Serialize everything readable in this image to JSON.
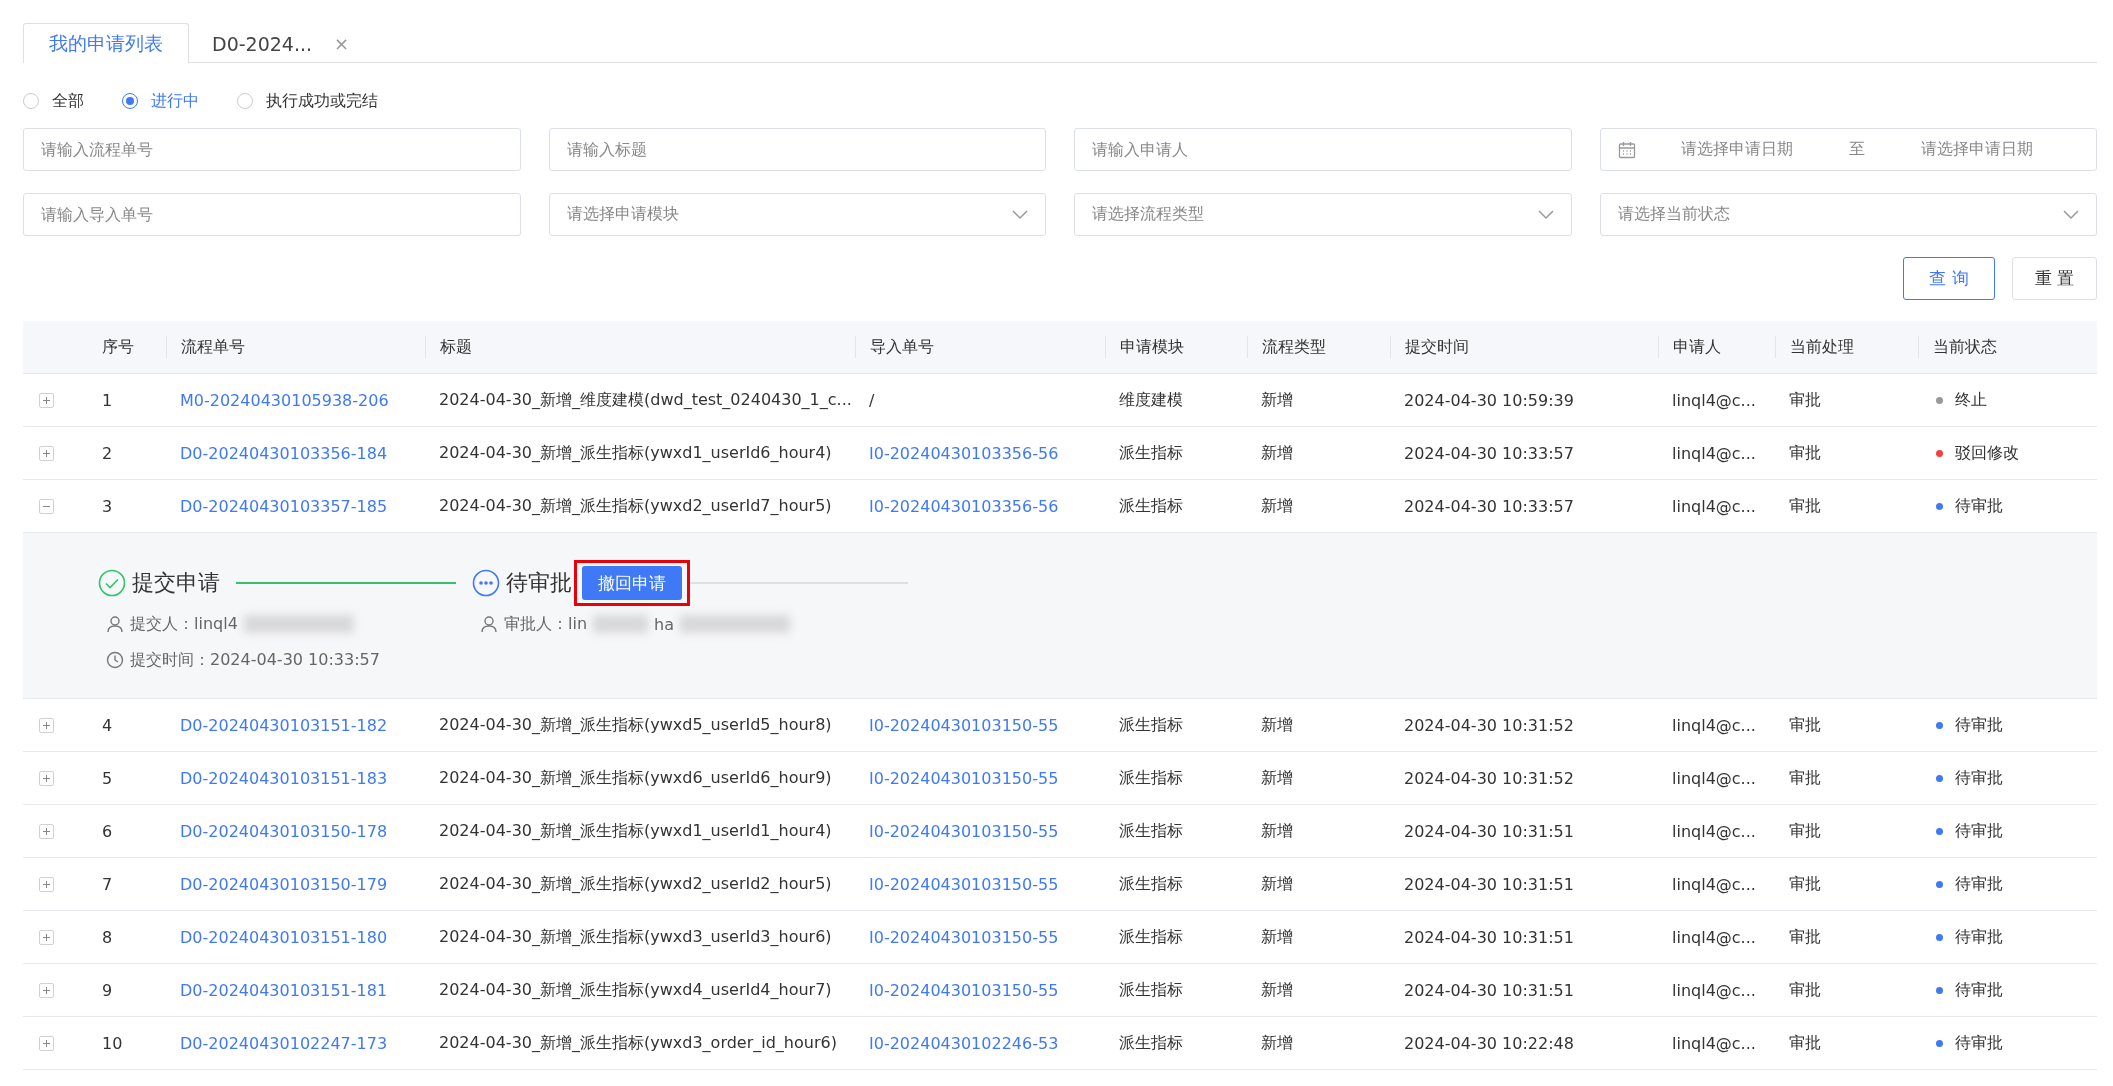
{
  "tabs": [
    {
      "label": "我的申请列表",
      "selected": true,
      "closable": false
    },
    {
      "label": "D0-2024...",
      "selected": false,
      "closable": true,
      "close_glyph": "×"
    }
  ],
  "status_filter": [
    {
      "label": "全部",
      "selected": false
    },
    {
      "label": "进行中",
      "selected": true
    },
    {
      "label": "执行成功或完结",
      "selected": false
    }
  ],
  "filters": [
    {
      "kind": "input",
      "placeholder": "请输入流程单号"
    },
    {
      "kind": "input",
      "placeholder": "请输入标题"
    },
    {
      "kind": "input",
      "placeholder": "请输入申请人"
    },
    {
      "kind": "daterange",
      "start_placeholder": "请选择申请日期",
      "separator": "至",
      "end_placeholder": "请选择申请日期"
    },
    {
      "kind": "input",
      "placeholder": "请输入导入单号"
    },
    {
      "kind": "select",
      "placeholder": "请选择申请模块"
    },
    {
      "kind": "select",
      "placeholder": "请选择流程类型"
    },
    {
      "kind": "select",
      "placeholder": "请选择当前状态"
    }
  ],
  "buttons": [
    {
      "label": "查 询",
      "kind": "primary"
    },
    {
      "label": "重 置",
      "kind": "default"
    }
  ],
  "table": {
    "columns": [
      "序号",
      "流程单号",
      "标题",
      "导入单号",
      "申请模块",
      "流程类型",
      "提交时间",
      "申请人",
      "当前处理",
      "当前状态"
    ],
    "rows": [
      {
        "expanded": false,
        "index": "1",
        "flow_no": "M0-20240430105938-206",
        "title": "2024-04-30_新增_维度建模(dwd_test_0240430_1_c...",
        "import_no": {
          "text": "/",
          "link": false
        },
        "module": "维度建模",
        "type": "新增",
        "time": "2024-04-30 10:59:39",
        "applicant": "linql4@c...",
        "handler": "审批",
        "status": {
          "label": "终止",
          "color": "#999999"
        }
      },
      {
        "expanded": false,
        "index": "2",
        "flow_no": "D0-20240430103356-184",
        "title": "2024-04-30_新增_派生指标(ywxd1_userId6_hour4)",
        "import_no": {
          "text": "I0-20240430103356-56",
          "link": true
        },
        "module": "派生指标",
        "type": "新增",
        "time": "2024-04-30 10:33:57",
        "applicant": "linql4@c...",
        "handler": "审批",
        "status": {
          "label": "驳回修改",
          "color": "#f5403d"
        }
      },
      {
        "expanded": true,
        "index": "3",
        "flow_no": "D0-20240430103357-185",
        "title": "2024-04-30_新增_派生指标(ywxd2_userId7_hour5)",
        "import_no": {
          "text": "I0-20240430103356-56",
          "link": true
        },
        "module": "派生指标",
        "type": "新增",
        "time": "2024-04-30 10:33:57",
        "applicant": "linql4@c...",
        "handler": "审批",
        "status": {
          "label": "待审批",
          "color": "#3f79f5"
        },
        "detail": {
          "steps": [
            {
              "label": "提交申请",
              "kind": "done",
              "lines": [
                {
                  "kind": "person",
                  "text": "提交人：linql4",
                  "redacted": true
                },
                {
                  "kind": "time",
                  "text": "提交时间：2024-04-30 10:33:57",
                  "redacted": false
                }
              ]
            },
            {
              "label": "待审批",
              "kind": "pending",
              "action": {
                "label": "撤回申请",
                "highlighted": true
              },
              "lines": [
                {
                  "kind": "person",
                  "text": "审批人：lin",
                  "redacted": true,
                  "tail": "ha"
                }
              ]
            }
          ]
        }
      },
      {
        "expanded": false,
        "index": "4",
        "flow_no": "D0-20240430103151-182",
        "title": "2024-04-30_新增_派生指标(ywxd5_userId5_hour8)",
        "import_no": {
          "text": "I0-20240430103150-55",
          "link": true
        },
        "module": "派生指标",
        "type": "新增",
        "time": "2024-04-30 10:31:52",
        "applicant": "linql4@c...",
        "handler": "审批",
        "status": {
          "label": "待审批",
          "color": "#3f79f5"
        }
      },
      {
        "expanded": false,
        "index": "5",
        "flow_no": "D0-20240430103151-183",
        "title": "2024-04-30_新增_派生指标(ywxd6_userId6_hour9)",
        "import_no": {
          "text": "I0-20240430103150-55",
          "link": true
        },
        "module": "派生指标",
        "type": "新增",
        "time": "2024-04-30 10:31:52",
        "applicant": "linql4@c...",
        "handler": "审批",
        "status": {
          "label": "待审批",
          "color": "#3f79f5"
        }
      },
      {
        "expanded": false,
        "index": "6",
        "flow_no": "D0-20240430103150-178",
        "title": "2024-04-30_新增_派生指标(ywxd1_userId1_hour4)",
        "import_no": {
          "text": "I0-20240430103150-55",
          "link": true
        },
        "module": "派生指标",
        "type": "新增",
        "time": "2024-04-30 10:31:51",
        "applicant": "linql4@c...",
        "handler": "审批",
        "status": {
          "label": "待审批",
          "color": "#3f79f5"
        }
      },
      {
        "expanded": false,
        "index": "7",
        "flow_no": "D0-20240430103150-179",
        "title": "2024-04-30_新增_派生指标(ywxd2_userId2_hour5)",
        "import_no": {
          "text": "I0-20240430103150-55",
          "link": true
        },
        "module": "派生指标",
        "type": "新增",
        "time": "2024-04-30 10:31:51",
        "applicant": "linql4@c...",
        "handler": "审批",
        "status": {
          "label": "待审批",
          "color": "#3f79f5"
        }
      },
      {
        "expanded": false,
        "index": "8",
        "flow_no": "D0-20240430103151-180",
        "title": "2024-04-30_新增_派生指标(ywxd3_userId3_hour6)",
        "import_no": {
          "text": "I0-20240430103150-55",
          "link": true
        },
        "module": "派生指标",
        "type": "新增",
        "time": "2024-04-30 10:31:51",
        "applicant": "linql4@c...",
        "handler": "审批",
        "status": {
          "label": "待审批",
          "color": "#3f79f5"
        }
      },
      {
        "expanded": false,
        "index": "9",
        "flow_no": "D0-20240430103151-181",
        "title": "2024-04-30_新增_派生指标(ywxd4_userId4_hour7)",
        "import_no": {
          "text": "I0-20240430103150-55",
          "link": true
        },
        "module": "派生指标",
        "type": "新增",
        "time": "2024-04-30 10:31:51",
        "applicant": "linql4@c...",
        "handler": "审批",
        "status": {
          "label": "待审批",
          "color": "#3f79f5"
        }
      },
      {
        "expanded": false,
        "index": "10",
        "flow_no": "D0-20240430102247-173",
        "title": "2024-04-30_新增_派生指标(ywxd3_order_id_hour6)",
        "import_no": {
          "text": "I0-20240430102246-53",
          "link": true
        },
        "module": "派生指标",
        "type": "新增",
        "time": "2024-04-30 10:22:48",
        "applicant": "linql4@c...",
        "handler": "审批",
        "status": {
          "label": "待审批",
          "color": "#3f79f5"
        }
      }
    ]
  }
}
